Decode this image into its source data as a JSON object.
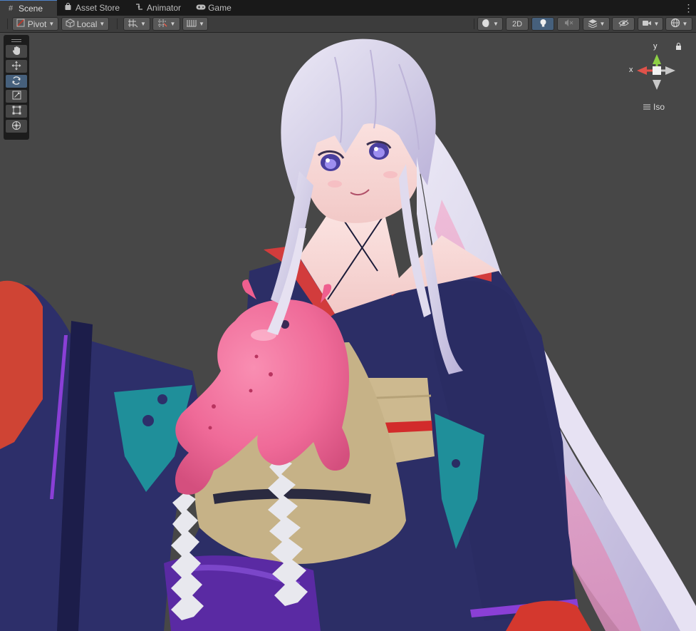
{
  "tabs": [
    {
      "label": "Scene",
      "icon": "grid-icon",
      "active": true
    },
    {
      "label": "Asset Store",
      "icon": "shopping-bag-icon",
      "active": false
    },
    {
      "label": "Animator",
      "icon": "animator-icon",
      "active": false
    },
    {
      "label": "Game",
      "icon": "gamepad-icon",
      "active": false
    }
  ],
  "toolbar": {
    "pivot_label": "Pivot",
    "local_label": "Local",
    "mode_2d_label": "2D"
  },
  "gizmo": {
    "x_label": "x",
    "y_label": "y",
    "projection_label": "Iso"
  },
  "colors": {
    "accent": "#4e82c9",
    "active_button": "#46607c",
    "scene_background": "#474747",
    "gizmo_x": "#e0524a",
    "gizmo_y": "#8dd145"
  }
}
